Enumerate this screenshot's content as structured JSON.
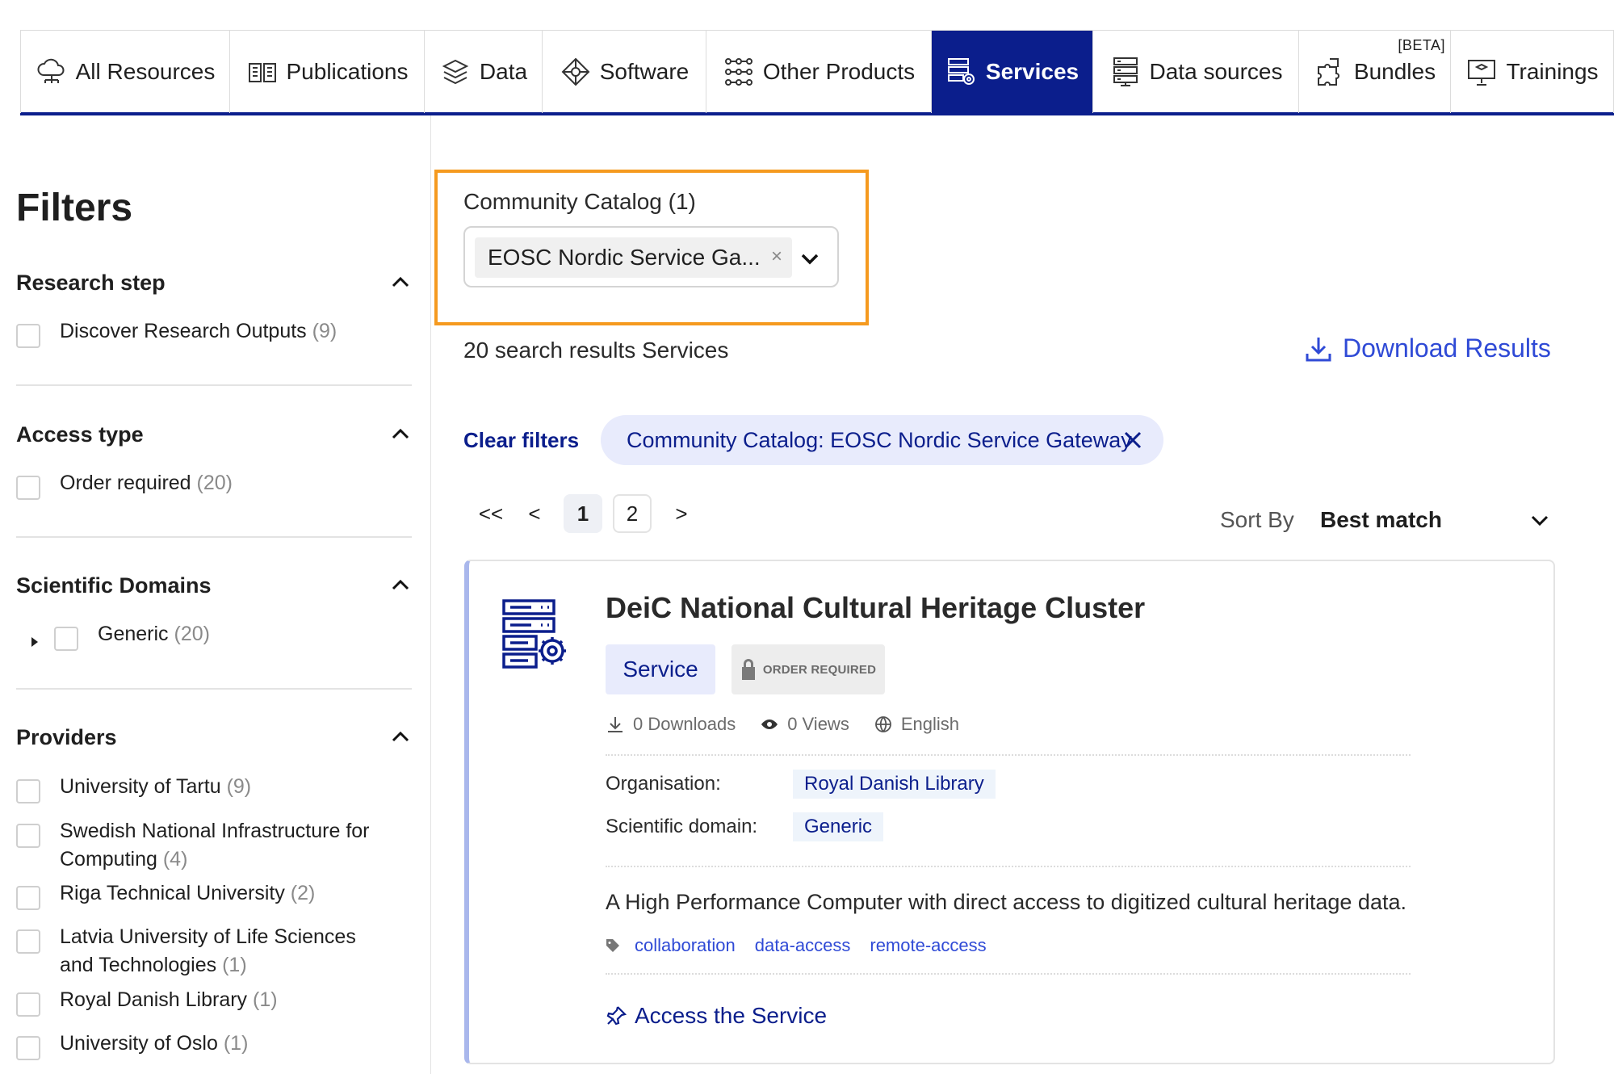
{
  "tabs": [
    {
      "label": "All Resources",
      "icon": "cloud-network-icon",
      "active": false
    },
    {
      "label": "Publications",
      "icon": "book-icon",
      "active": false
    },
    {
      "label": "Data",
      "icon": "layers-icon",
      "active": false
    },
    {
      "label": "Software",
      "icon": "software-icon",
      "active": false
    },
    {
      "label": "Other Products",
      "icon": "grid-nodes-icon",
      "active": false
    },
    {
      "label": "Services",
      "icon": "server-gear-icon",
      "active": true
    },
    {
      "label": "Data sources",
      "icon": "database-rack-icon",
      "active": false
    },
    {
      "label": "Bundles",
      "icon": "puzzle-icon",
      "active": false,
      "badge": "[BETA]"
    },
    {
      "label": "Trainings",
      "icon": "presentation-icon",
      "active": false
    }
  ],
  "filters": {
    "title": "Filters",
    "research_step": {
      "title": "Research step",
      "options": [
        {
          "label": "Discover Research Outputs",
          "count": "(9)"
        }
      ]
    },
    "access_type": {
      "title": "Access type",
      "options": [
        {
          "label": "Order required",
          "count": "(20)"
        }
      ]
    },
    "scientific_domains": {
      "title": "Scientific Domains",
      "options": [
        {
          "label": "Generic",
          "count": "(20)"
        }
      ]
    },
    "providers": {
      "title": "Providers",
      "options": [
        {
          "label": "University of Tartu",
          "count": "(9)"
        },
        {
          "label": "Swedish National Infrastructure for",
          "label2": "Computing",
          "count": "(4)"
        },
        {
          "label": "Riga Technical University",
          "count": "(2)"
        },
        {
          "label": "Latvia University of Life Sciences",
          "label2": "and Technologies",
          "count": "(1)"
        },
        {
          "label": "Royal Danish Library",
          "count": "(1)"
        },
        {
          "label": "University of Oslo",
          "count": "(1)"
        }
      ]
    }
  },
  "catalog": {
    "label": "Community Catalog (1)",
    "selected": "EOSC Nordic Service Ga...",
    "remove": "×"
  },
  "results": {
    "count_text": "20 search results Services",
    "download_label": "Download Results",
    "clear_filters": "Clear filters",
    "active_filter": "Community Catalog: EOSC Nordic Service Gateway"
  },
  "pagination": {
    "first": "<<",
    "prev": "<",
    "pages": [
      "1",
      "2"
    ],
    "next": ">"
  },
  "sort": {
    "label": "Sort By",
    "value": "Best match"
  },
  "card": {
    "title": "DeiC National Cultural Heritage Cluster",
    "type_badge": "Service",
    "order_badge": "ORDER REQUIRED",
    "downloads": "0 Downloads",
    "views": "0 Views",
    "language": "English",
    "organisation_label": "Organisation:",
    "organisation_value": "Royal Danish Library",
    "domain_label": "Scientific domain:",
    "domain_value": "Generic",
    "description": "A High Performance Computer with direct access to digitized cultural heritage data.",
    "tags": [
      "collaboration",
      "data-access",
      "remote-access"
    ],
    "access_label": "Access the Service"
  },
  "colors": {
    "accent_navy": "#0b1e8c",
    "link_blue": "#2f4ad6",
    "highlight_orange": "#f59a1f",
    "chip_bg": "#e8ebfc"
  }
}
